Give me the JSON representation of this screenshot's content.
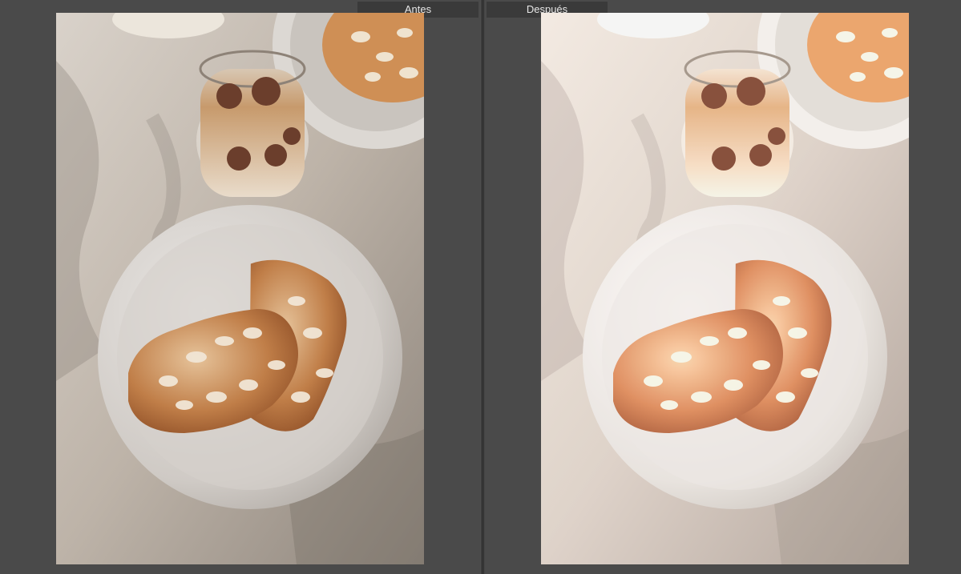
{
  "compare": {
    "before_label": "Antes",
    "after_label": "Después"
  },
  "colors": {
    "workspace_bg": "#4a4a4a",
    "label_bg": "#3a3a3a",
    "label_text": "#e6e6e6",
    "cloth": "#cfc6bd",
    "plate": "#d8d4d0",
    "pastry": "#b8703e",
    "coffee": "#c8a17a"
  },
  "icons": {
    "photo_before": "photo-image",
    "photo_after": "photo-image"
  }
}
